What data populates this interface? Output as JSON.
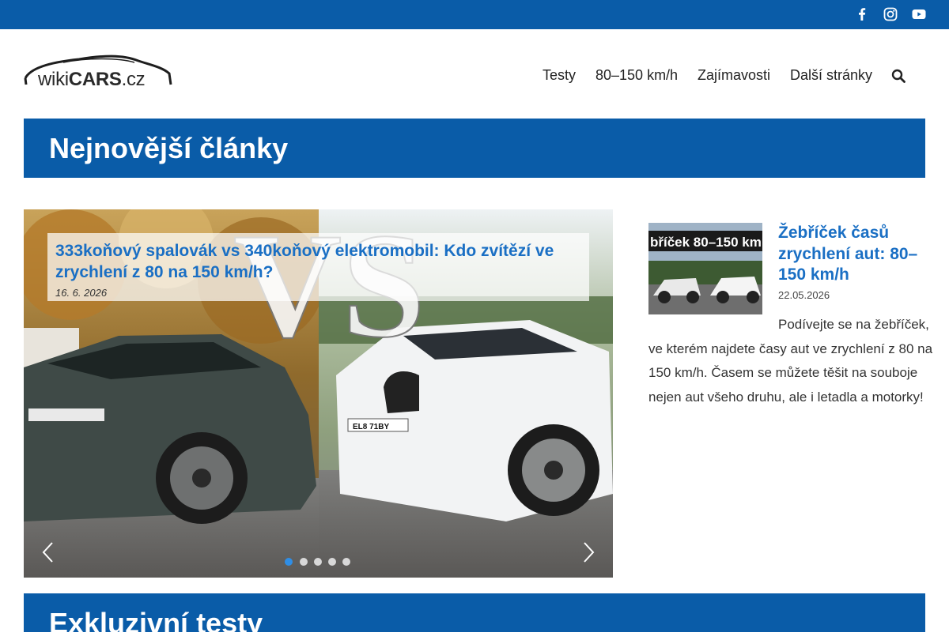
{
  "social": {
    "icons": [
      "facebook-icon",
      "instagram-icon",
      "youtube-icon"
    ]
  },
  "logo": {
    "text_wiki": "wiki",
    "text_cars": "CARS",
    "text_tld": ".cz"
  },
  "nav": {
    "items": [
      "Testy",
      "80–150 km/h",
      "Zajímavosti",
      "Další stránky"
    ]
  },
  "section_latest": {
    "title": "Nejnovější články"
  },
  "slider": {
    "caption_title": "333koňový spalovák vs 340koňový elektromobil: Kdo zvítězí ve zrychlení z 80 na 150 km/h?",
    "caption_date": "16. 6. 2026",
    "overlay_text": "VS",
    "plate_right": "EL8 71BY",
    "slide_count": 5,
    "active_slide": 1
  },
  "side_article": {
    "thumb_text": "bříček 80–150 km",
    "title": "Žebříček časů zrychlení aut: 80–150 km/h",
    "date": "22.05.2026",
    "excerpt": "Podívejte se na žebříček, ve kterém najdete časy aut ve zrychlení z 80 na 150 km/h. Časem se můžete těšit na souboje nejen aut všeho druhu, ale i letadla a motorky!"
  },
  "section_exclusive": {
    "title": "Exkluzivní testy"
  },
  "colors": {
    "brand_blue": "#0a5ca8",
    "link_blue": "#1a6fc4",
    "dot_active": "#2f8ee6"
  }
}
